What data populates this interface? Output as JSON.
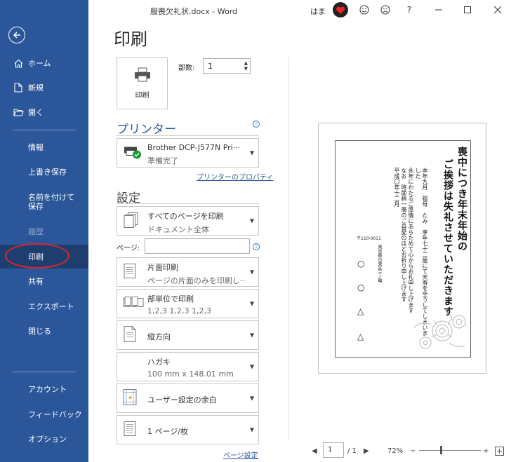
{
  "window": {
    "title": "服喪欠礼状.docx  -  Word",
    "user": "はま",
    "help": "?"
  },
  "sidebar": {
    "items": [
      {
        "label": "ホーム"
      },
      {
        "label": "新規"
      },
      {
        "label": "開く"
      },
      {
        "label": "情報"
      },
      {
        "label": "上書き保存"
      },
      {
        "label": "名前を付けて保存"
      },
      {
        "label": "履歴"
      },
      {
        "label": "印刷"
      },
      {
        "label": "共有"
      },
      {
        "label": "エクスポート"
      },
      {
        "label": "閉じる"
      },
      {
        "label": "アカウント"
      },
      {
        "label": "フィードバック"
      },
      {
        "label": "オプション"
      }
    ]
  },
  "print": {
    "heading": "印刷",
    "print_button": "印刷",
    "copies_label": "部数:",
    "copies_value": "1",
    "printer_title": "プリンター",
    "printer_name": "Brother DCP-J577N Pri···",
    "printer_status": "準備完了",
    "printer_props": "プリンターのプロパティ",
    "settings_title": "設定",
    "pages_label": "ページ:",
    "pages_value": "",
    "settings": [
      {
        "l1": "すべてのページを印刷",
        "l2": "ドキュメント全体"
      },
      {
        "l1": "片面印刷",
        "l2": "ページの片面のみを印刷し···"
      },
      {
        "l1": "部単位で印刷",
        "l2": "1,2,3    1,2,3    1,2,3"
      },
      {
        "l1": "縦方向",
        "l2": ""
      },
      {
        "l1": "ハガキ",
        "l2": "100 mm x 148.01 mm"
      },
      {
        "l1": "ユーザー設定の余白",
        "l2": ""
      },
      {
        "l1": "1 ページ/枚",
        "l2": ""
      }
    ],
    "page_setup": "ページ設定"
  },
  "preview": {
    "heading_line1": "喪中につき年末年始の",
    "heading_line2": "ご挨拶は失礼させていただきます",
    "body": [
      "本年九月　祖母　たみ　享年七十二歳にて天寿を全うしてしまいま",
      "した",
      "永年にわたるご厚情にあらためて心からお礼申し上げます",
      "なお　時節柄一層のご自愛のほどお祈り申し上げます",
      "平成〇年十二月"
    ],
    "postal": "〒110-0011",
    "address": "東京都台東区三ノ輪",
    "marks": [
      "○",
      "○",
      "△",
      "△"
    ]
  },
  "bottom": {
    "current_page": "1",
    "total_pages": "/ 1",
    "zoom": "72%",
    "minus": "−",
    "plus": "+"
  },
  "colors": {
    "sidebar": "#2b579a",
    "sidebar_active": "#1e3e6f",
    "accent": "#2b579a",
    "annotation": "#e0242a"
  }
}
